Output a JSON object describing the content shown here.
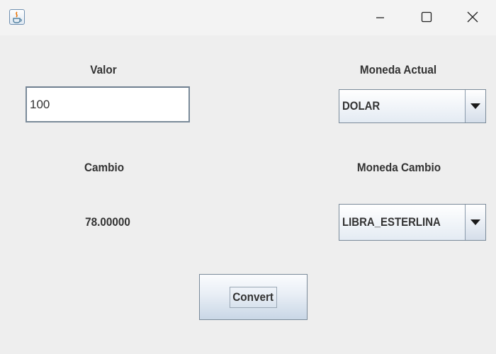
{
  "window": {
    "title": "",
    "icon": "java-app-icon",
    "controls": [
      "minimize-icon",
      "maximize-icon",
      "close-icon"
    ]
  },
  "form": {
    "valor_label": "Valor",
    "valor_value": "100",
    "moneda_actual_label": "Moneda Actual",
    "moneda_actual_selected": "DOLAR",
    "cambio_label": "Cambio",
    "cambio_result": "78.00000",
    "moneda_cambio_label": "Moneda Cambio",
    "moneda_cambio_selected": "LIBRA_ESTERLINA",
    "convert_label": "Convert"
  },
  "colors": {
    "background": "#eeeeee",
    "titlebar": "#f3f3f3",
    "text": "#333333",
    "border": "#7a8a99"
  }
}
